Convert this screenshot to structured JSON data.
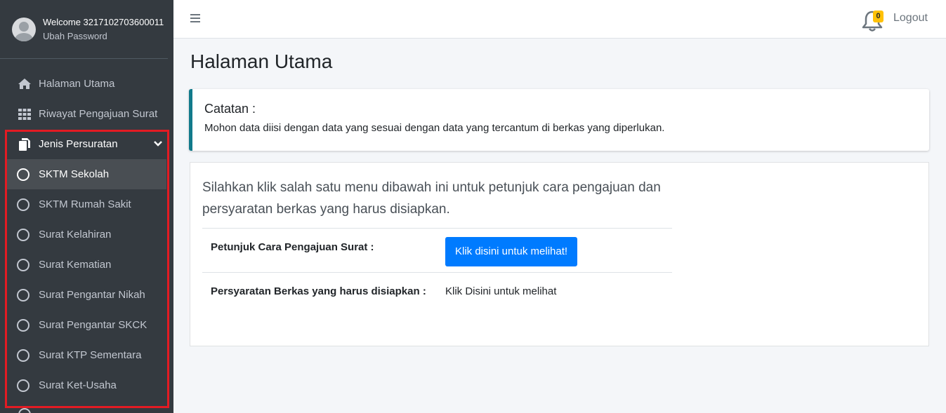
{
  "sidebar": {
    "user": {
      "welcome": "Welcome 3217102703600011",
      "change_password": "Ubah Password"
    },
    "menu": [
      {
        "label": "Halaman Utama",
        "icon": "home-icon"
      },
      {
        "label": "Riwayat Pengajuan Surat",
        "icon": "grid-icon"
      },
      {
        "label": "Jenis Persuratan",
        "icon": "copy-icon"
      }
    ],
    "submenu": [
      {
        "label": "SKTM Sekolah"
      },
      {
        "label": "SKTM Rumah Sakit"
      },
      {
        "label": "Surat Kelahiran"
      },
      {
        "label": "Surat Kematian"
      },
      {
        "label": "Surat Pengantar Nikah"
      },
      {
        "label": "Surat Pengantar SKCK"
      },
      {
        "label": "Surat KTP Sementara"
      },
      {
        "label": "Surat Ket-Usaha"
      }
    ]
  },
  "topbar": {
    "notification_count": "0",
    "logout_label": "Logout"
  },
  "main": {
    "page_title": "Halaman Utama",
    "callout": {
      "title": "Catatan :",
      "text": "Mohon data diisi dengan data yang sesuai dengan data yang tercantum di berkas yang diperlukan."
    },
    "card": {
      "lead": "Silahkan klik salah satu menu dibawah ini untuk petunjuk cara pengajuan dan persyaratan berkas yang harus disiapkan.",
      "rows": [
        {
          "label": "Petunjuk Cara Pengajuan Surat :",
          "button": "Klik disini untuk melihat!"
        },
        {
          "label": "Persyaratan Berkas yang harus disiapkan :",
          "value": "Klik Disini untuk melihat"
        }
      ]
    }
  },
  "colors": {
    "sidebar_bg": "#343a40",
    "primary": "#007bff",
    "callout_border": "#117a8b",
    "highlight": "#e31b23",
    "badge": "#ffc107"
  }
}
